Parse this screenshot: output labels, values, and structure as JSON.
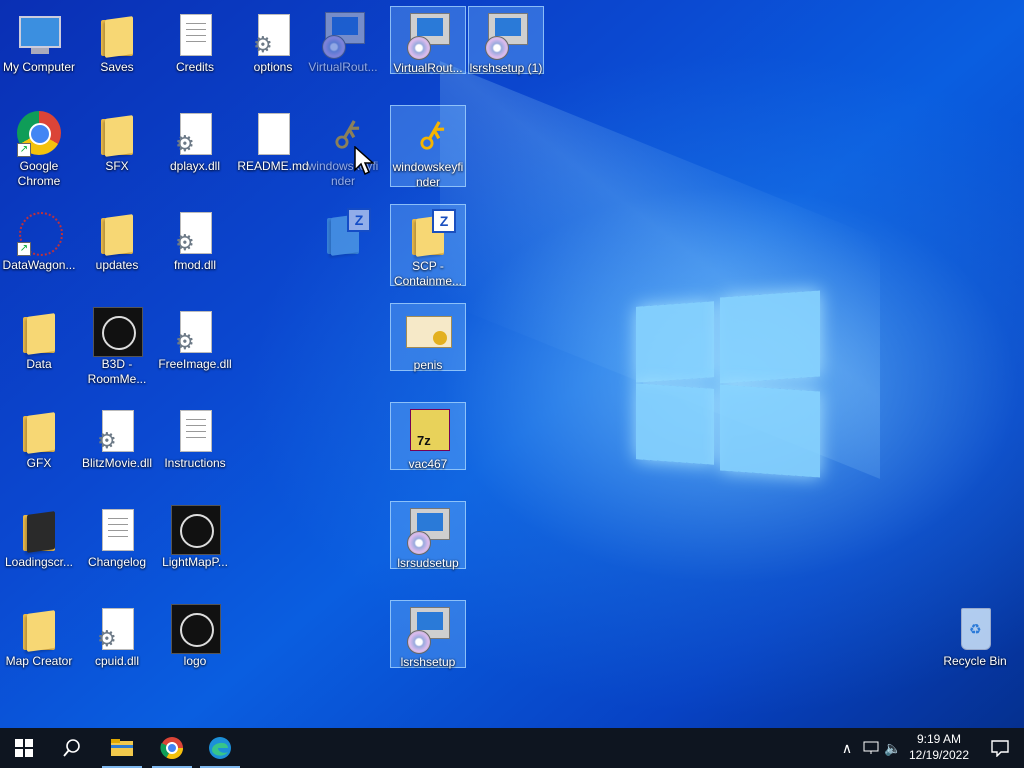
{
  "desktop_icons": [
    {
      "label": "My Computer",
      "icon": "computer-icon"
    },
    {
      "label": "Saves",
      "icon": "folder-icon"
    },
    {
      "label": "Credits",
      "icon": "text-file-icon"
    },
    {
      "label": "options",
      "icon": "config-file-icon"
    },
    {
      "label": "VirtualRout...",
      "icon": "installer-icon"
    },
    {
      "label": "VirtualRout...",
      "icon": "installer-icon"
    },
    {
      "label": "lsrshsetup (1)",
      "icon": "installer-icon"
    },
    {
      "label": "Google Chrome",
      "icon": "chrome-icon"
    },
    {
      "label": "SFX",
      "icon": "folder-icon"
    },
    {
      "label": "dplayx.dll",
      "icon": "dll-file-icon"
    },
    {
      "label": "README.md",
      "icon": "blank-file-icon"
    },
    {
      "label": "windowskeyfinder",
      "icon": "key-icon"
    },
    {
      "label": "windowskeyfinder",
      "icon": "key-icon"
    },
    {
      "label": "DataWagon...",
      "icon": "datawagon-icon"
    },
    {
      "label": "updates",
      "icon": "folder-icon"
    },
    {
      "label": "fmod.dll",
      "icon": "dll-file-icon"
    },
    {
      "label": "SCP - Containme...",
      "icon": "zip-folder-icon"
    },
    {
      "label": "Data",
      "icon": "folder-icon"
    },
    {
      "label": "B3D - RoomMe...",
      "icon": "scp-logo-icon"
    },
    {
      "label": "FreeImage.dll",
      "icon": "dll-file-icon"
    },
    {
      "label": "penis",
      "icon": "certificate-icon"
    },
    {
      "label": "GFX",
      "icon": "folder-icon"
    },
    {
      "label": "BlitzMovie.dll",
      "icon": "dll-file-icon"
    },
    {
      "label": "Instructions",
      "icon": "text-file-icon"
    },
    {
      "label": "vac467",
      "icon": "7z-archive-icon"
    },
    {
      "label": "Loadingscr...",
      "icon": "folder-icon"
    },
    {
      "label": "Changelog",
      "icon": "text-file-icon"
    },
    {
      "label": "LightMapP...",
      "icon": "scp-logo-icon"
    },
    {
      "label": "lsrsudsetup",
      "icon": "installer-icon"
    },
    {
      "label": "Map Creator",
      "icon": "folder-icon"
    },
    {
      "label": "cpuid.dll",
      "icon": "dll-file-icon"
    },
    {
      "label": "logo",
      "icon": "scp-logo-icon"
    },
    {
      "label": "lsrshsetup",
      "icon": "installer-icon"
    },
    {
      "label": "Recycle Bin",
      "icon": "recycle-bin-icon"
    }
  ],
  "taskbar": {
    "start_icon": "windows-start-icon",
    "search_icon": "search-icon",
    "pinned": [
      "file-explorer-icon",
      "chrome-icon",
      "edge-icon"
    ],
    "tray": [
      "chevron-up-icon",
      "network-icon",
      "volume-icon"
    ],
    "time": "9:19 AM",
    "date": "12/19/2022",
    "notification_icon": "notification-icon"
  },
  "colors": {
    "wallpaper_primary": "#0a4fd6",
    "wallpaper_glow": "#8fd2ff",
    "taskbar_bg": "#0e1520",
    "selection": "#78beff"
  }
}
